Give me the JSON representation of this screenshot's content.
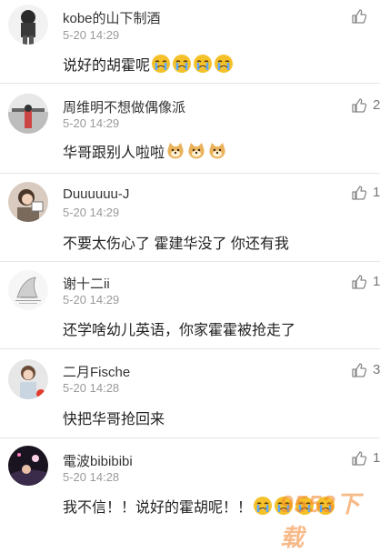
{
  "comments": [
    {
      "username": "kobe的山下制酒",
      "time": "5-20 14:29",
      "text": "说好的胡霍呢",
      "emoji": "crying-face",
      "emoji_count": 4,
      "likes": ""
    },
    {
      "username": "周维明不想做偶像派",
      "time": "5-20 14:29",
      "text": "华哥跟别人啦啦",
      "emoji": "doge-face",
      "emoji_count": 3,
      "likes": "2"
    },
    {
      "username": "Duuuuuu-J",
      "time": "5-20 14:29",
      "text": "不要太伤心了 霍建华没了 你还有我",
      "likes": "1"
    },
    {
      "username": "谢十二ii",
      "time": "5-20 14:29",
      "text": "还学啥幼儿英语，你家霍霍被抢走了",
      "likes": "1"
    },
    {
      "username": "二月Fische",
      "time": "5-20 14:28",
      "text": "快把华哥抢回来",
      "likes": "3"
    },
    {
      "username": "電波bibibibi",
      "time": "5-20 14:28",
      "text": "我不信！！说好的霍胡呢！！",
      "emoji": "crying-face",
      "emoji_count": 4,
      "likes": "1"
    }
  ],
  "watermark": "9553下载",
  "icons": {
    "like": "thumbs-up-icon"
  }
}
